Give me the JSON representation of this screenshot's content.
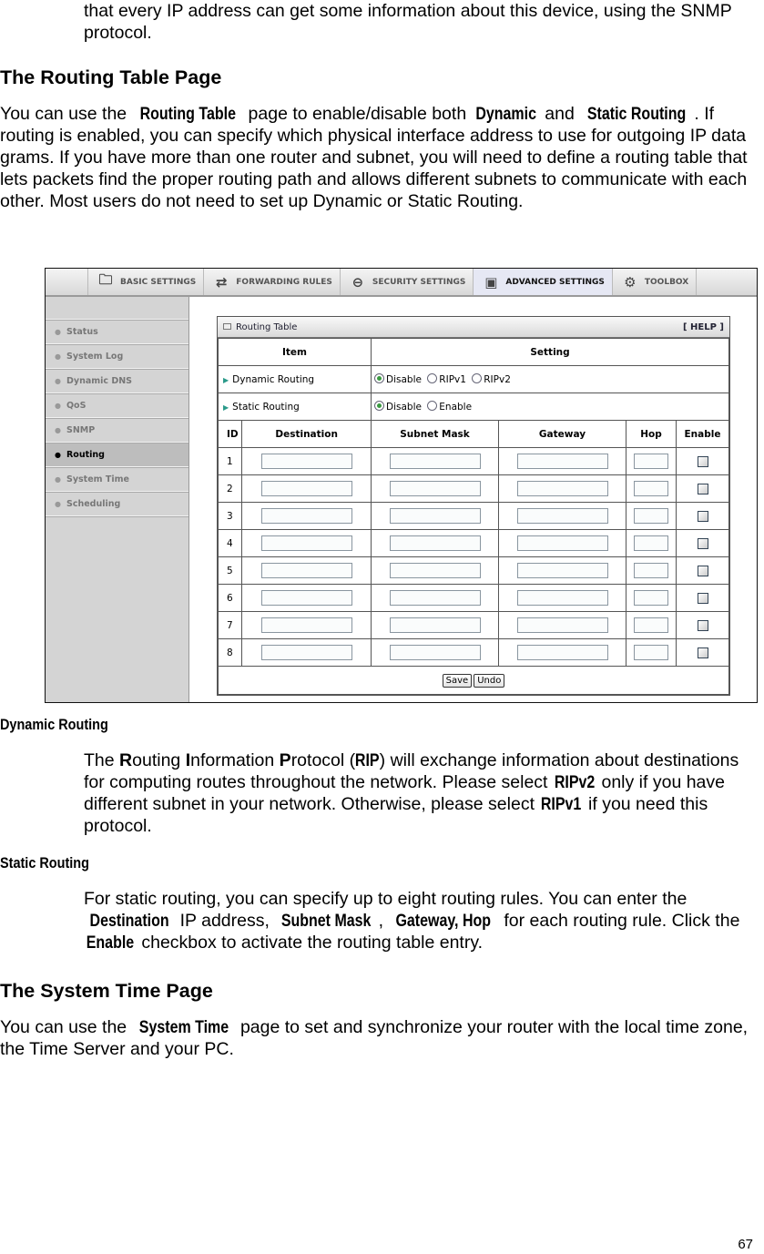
{
  "intro_continuation": "that every IP address can get some information about this device, using the SNMP protocol.",
  "section_routing": {
    "heading": "The Routing Table Page",
    "p1_a": "You can use the ",
    "p1_b": "Routing Table",
    "p1_c": " page to enable/disable both ",
    "p1_d": "Dynamic",
    "p1_e": " and ",
    "p1_f": "Static Routing",
    "p1_g": ". If routing is enabled, you can specify which physical interface address to use for outgoing IP data grams. If you have more than one router and subnet, you will need to define a routing table that lets packets find the proper routing path and allows different subnets to communicate with each other. Most users do not need to set up Dynamic or Static Routing."
  },
  "screenshot": {
    "nav_tabs": [
      {
        "label": "BASIC SETTINGS",
        "icon": "folder-icon",
        "active": false
      },
      {
        "label": "FORWARDING RULES",
        "icon": "forwarding-icon",
        "active": false
      },
      {
        "label": "SECURITY SETTINGS",
        "icon": "security-icon",
        "active": false
      },
      {
        "label": "ADVANCED SETTINGS",
        "icon": "advanced-icon",
        "active": true
      },
      {
        "label": "TOOLBOX",
        "icon": "toolbox-icon",
        "active": false
      }
    ],
    "sidebar": [
      {
        "label": "Status",
        "active": false
      },
      {
        "label": "System Log",
        "active": false
      },
      {
        "label": "Dynamic DNS",
        "active": false
      },
      {
        "label": "QoS",
        "active": false
      },
      {
        "label": "SNMP",
        "active": false
      },
      {
        "label": "Routing",
        "active": true
      },
      {
        "label": "System Time",
        "active": false
      },
      {
        "label": "Scheduling",
        "active": false
      }
    ],
    "panel": {
      "title": "Routing Table",
      "help": "[ HELP ]",
      "col_item": "Item",
      "col_setting": "Setting",
      "dynamic_label": "Dynamic Routing",
      "dynamic_options": [
        "Disable",
        "RIPv1",
        "RIPv2"
      ],
      "dynamic_selected": "Disable",
      "static_label": "Static Routing",
      "static_options": [
        "Disable",
        "Enable"
      ],
      "static_selected": "Disable",
      "table_headers": [
        "ID",
        "Destination",
        "Subnet Mask",
        "Gateway",
        "Hop",
        "Enable"
      ],
      "rows": [
        {
          "id": "1",
          "destination": "",
          "subnet_mask": "",
          "gateway": "",
          "hop": "",
          "enabled": false
        },
        {
          "id": "2",
          "destination": "",
          "subnet_mask": "",
          "gateway": "",
          "hop": "",
          "enabled": false
        },
        {
          "id": "3",
          "destination": "",
          "subnet_mask": "",
          "gateway": "",
          "hop": "",
          "enabled": false
        },
        {
          "id": "4",
          "destination": "",
          "subnet_mask": "",
          "gateway": "",
          "hop": "",
          "enabled": false
        },
        {
          "id": "5",
          "destination": "",
          "subnet_mask": "",
          "gateway": "",
          "hop": "",
          "enabled": false
        },
        {
          "id": "6",
          "destination": "",
          "subnet_mask": "",
          "gateway": "",
          "hop": "",
          "enabled": false
        },
        {
          "id": "7",
          "destination": "",
          "subnet_mask": "",
          "gateway": "",
          "hop": "",
          "enabled": false
        },
        {
          "id": "8",
          "destination": "",
          "subnet_mask": "",
          "gateway": "",
          "hop": "",
          "enabled": false
        }
      ],
      "save_label": "Save",
      "undo_label": "Undo"
    }
  },
  "dynamic_routing": {
    "heading": "Dynamic Routing",
    "t1": "The ",
    "b1": "R",
    "t2": "outing ",
    "b2": "I",
    "t3": "nformation ",
    "b3": "P",
    "t4": "rotocol (",
    "b4": "RIP",
    "t5": ") will exchange information about destinations for computing routes throughout the network. Please select ",
    "b5": "RIPv2",
    "t6": " only if you have different subnet in your network. Otherwise, please select ",
    "b6": "RIPv1",
    "t7": " if you need this protocol."
  },
  "static_routing": {
    "heading": "Static Routing",
    "t1": "For static routing, you can specify up to eight routing rules. You can enter the ",
    "b1": "Destination",
    "t2": " IP address, ",
    "b2": "Subnet Mask",
    "t3": ", ",
    "b3": "Gateway, Hop",
    "t4": " for each routing rule. Click the ",
    "b4": "Enable",
    "t5": " checkbox to activate the routing table entry."
  },
  "section_time": {
    "heading": "The System Time Page",
    "t1": "You can use the ",
    "b1": "System Time",
    "t2": " page to set and synchronize your router with the local time zone, the Time Server and your PC."
  },
  "page_number": "67"
}
